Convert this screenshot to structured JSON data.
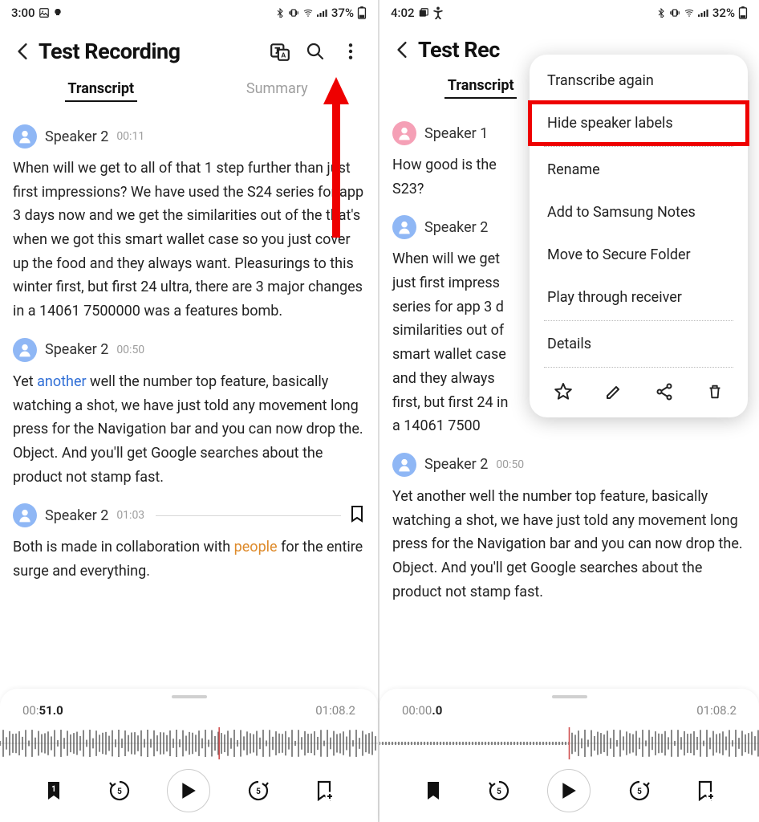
{
  "left": {
    "status": {
      "time": "3:00",
      "battery": "37%"
    },
    "title": "Test Recording",
    "tabs": {
      "transcript": "Transcript",
      "summary": "Summary"
    },
    "segments": [
      {
        "speaker": "Speaker 2",
        "ts": "00:11",
        "avatar": "blue",
        "text_parts": [
          "When will we get to all of that 1 step further than just first impressions? We have used the S24 series for app 3 days now and we get the similarities out of the that's when we got this smart wallet case so you just cover up the food and they always want. Pleasurings to this winter first, but first 24 ultra, there are 3 major changes in a 14061 7500000 was a features bomb."
        ]
      },
      {
        "speaker": "Speaker 2",
        "ts": "00:50",
        "avatar": "blue",
        "text_parts": [
          "Yet ",
          {
            "hl": "blue",
            "t": "another"
          },
          " well the number top feature, basically watching a shot, we have just told any movement long press for the Navigation bar and you can now drop the. Object. And you'll get Google searches about the product not stamp fast."
        ]
      },
      {
        "speaker": "Speaker 2",
        "ts": "01:03",
        "avatar": "blue",
        "bookmark": true,
        "text_parts": [
          "Both is made in collaboration with ",
          {
            "hl": "orange",
            "t": "people"
          },
          " for the entire surge and everything."
        ]
      }
    ],
    "player": {
      "cur_pre": "00:",
      "cur_bold": "51.0",
      "dur": "01:08.2",
      "bookmark_badge": "1"
    }
  },
  "right": {
    "status": {
      "time": "4:02",
      "battery": "32%"
    },
    "title": "Test Rec",
    "tabs": {
      "transcript": "Transcript",
      "summary": ""
    },
    "segments": [
      {
        "speaker": "Speaker 1",
        "ts": "",
        "avatar": "pink",
        "text_parts": [
          "How good is the S23?"
        ]
      },
      {
        "speaker": "Speaker 2",
        "ts": "",
        "avatar": "blue",
        "text_parts": [
          "When will we get just first impress series for app 3 d similarities out of smart wallet case and they always first, but first 24 in a 14061 7500"
        ]
      },
      {
        "speaker": "Speaker 2",
        "ts": "00:50",
        "avatar": "blue",
        "text_parts": [
          "Yet another well the number top feature, basically watching a shot, we have just told any movement long press for the Navigation bar and you can now drop the. Object. And you'll get Google searches about the product not stamp fast."
        ]
      }
    ],
    "menu": {
      "items": [
        "Transcribe again",
        "Hide speaker labels",
        "Rename",
        "Add to Samsung Notes",
        "Move to Secure Folder",
        "Play through receiver",
        "Details"
      ],
      "highlight_index": 1
    },
    "player": {
      "cur_pre": "00:00",
      "cur_bold": ".0",
      "dur": "01:08.2",
      "bookmark_badge": ""
    }
  }
}
